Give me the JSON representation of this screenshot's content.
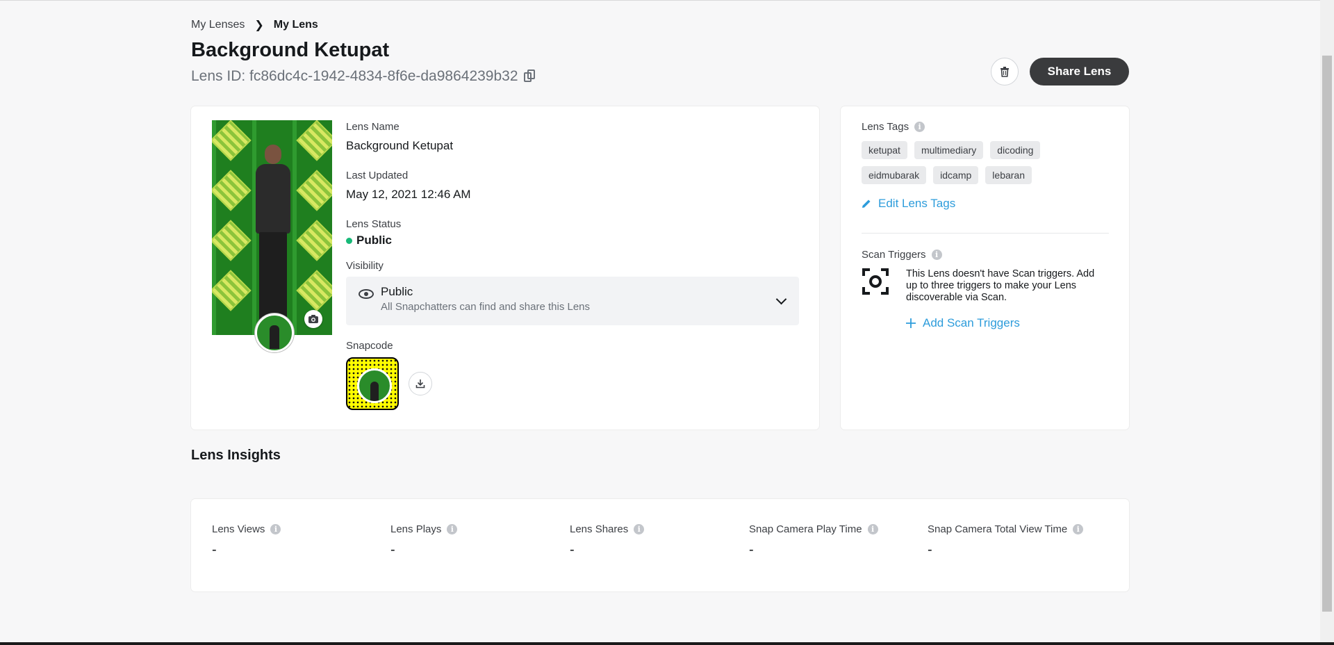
{
  "breadcrumb": {
    "parent": "My Lenses",
    "current": "My Lens"
  },
  "page": {
    "title": "Background Ketupat",
    "lens_id": "Lens ID: fc86dc4c-1942-4834-8f6e-da9864239b32"
  },
  "actions": {
    "share_label": "Share Lens",
    "delete_icon": "trash-icon"
  },
  "details": {
    "lens_name_label": "Lens Name",
    "lens_name": "Background Ketupat",
    "last_updated_label": "Last Updated",
    "last_updated": "May 12, 2021 12:46 AM",
    "status_label": "Lens Status",
    "status": "Public",
    "status_color": "#17b978",
    "visibility_label": "Visibility",
    "visibility_value": "Public",
    "visibility_desc": "All Snapchatters can find and share this Lens",
    "snapcode_label": "Snapcode"
  },
  "tags": {
    "label": "Lens Tags",
    "items": [
      "ketupat",
      "multimediary",
      "dicoding",
      "eidmubarak",
      "idcamp",
      "lebaran"
    ],
    "edit_label": "Edit Lens Tags"
  },
  "scan": {
    "label": "Scan Triggers",
    "text": "This Lens doesn't have Scan triggers. Add up to three triggers to make your Lens discoverable via Scan.",
    "add_label": "Add Scan Triggers"
  },
  "insights": {
    "title": "Lens Insights",
    "metrics": [
      {
        "label": "Lens Views",
        "value": "-"
      },
      {
        "label": "Lens Plays",
        "value": "-"
      },
      {
        "label": "Lens Shares",
        "value": "-"
      },
      {
        "label": "Snap Camera Play Time",
        "value": "-"
      },
      {
        "label": "Snap Camera Total View Time",
        "value": "-"
      }
    ]
  },
  "colors": {
    "accent": "#2d9cdb",
    "primary_button": "#3a3b3d",
    "snapcode": "#fffc00"
  }
}
